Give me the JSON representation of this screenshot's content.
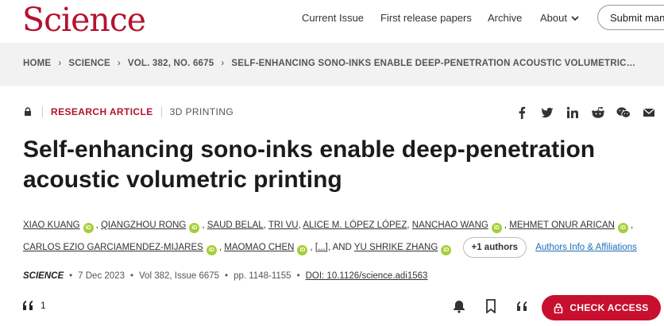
{
  "header": {
    "logo": "Science",
    "nav": [
      "Current Issue",
      "First release papers",
      "Archive",
      "About"
    ],
    "submit": "Submit man"
  },
  "breadcrumb": [
    "HOME",
    "SCIENCE",
    "VOL. 382, NO. 6675",
    "SELF-ENHANCING SONO-INKS ENABLE DEEP-PENETRATION ACOUSTIC VOLUMETRIC…"
  ],
  "article": {
    "type": "RESEARCH ARTICLE",
    "subject": "3D PRINTING",
    "title_line1": "Self-enhancing sono-inks enable deep-penetration",
    "title_line2": "acoustic volumetric printing",
    "authors": [
      "XIAO KUANG",
      "QIANGZHOU RONG",
      "SAUD BELAL",
      "TRI VU",
      "ALICE M. LÓPEZ LÓPEZ",
      "NANCHAO WANG",
      "MEHMET ONUR ARICAN",
      "CARLOS EZIO GARCIAMENDEZ-MIJARES",
      "MAOMAO CHEN",
      "YU SHRIKE ZHANG"
    ],
    "orcid_label": "iD",
    "comma": ",",
    "ellipsis": "[...]",
    "and_text": ", AND",
    "plus_authors": "+1 authors",
    "affiliations_link": "Authors Info & Affiliations",
    "journal": "SCIENCE",
    "date": "7 Dec 2023",
    "volume": "Vol 382, Issue 6675",
    "pages": "pp. 1148-1155",
    "doi": "DOI: 10.1126/science.adi1563",
    "dot": "•"
  },
  "toolbar": {
    "citations": "1",
    "check_access": "CHECK ACCESS"
  },
  "icons": [
    "lock-icon",
    "facebook-icon",
    "twitter-icon",
    "linkedin-icon",
    "reddit-icon",
    "wechat-icon",
    "email-icon",
    "quote-icon",
    "bell-icon",
    "bookmark-icon",
    "cite-icon"
  ],
  "colors": {
    "brand": "#b5122e",
    "button": "#c8102e",
    "orcid": "#a6ce39",
    "link": "#1c6fb8"
  }
}
